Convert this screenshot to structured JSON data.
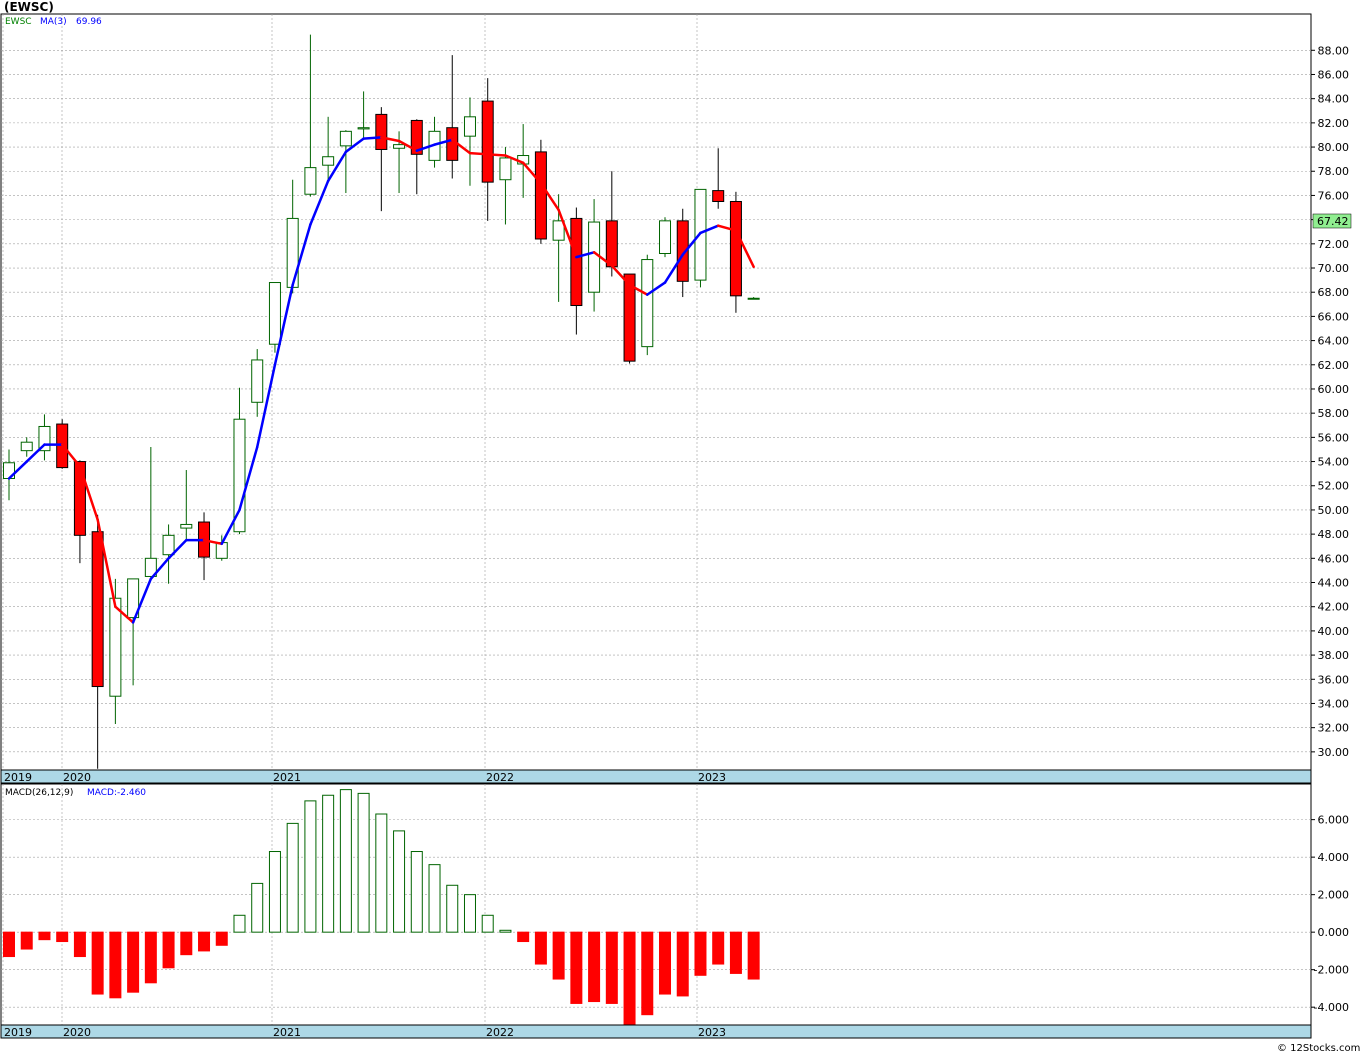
{
  "title": "(EWSC)",
  "footer": "© 12Stocks.com",
  "colors": {
    "up": "#006400",
    "down": "#ff0000",
    "ma_up": "#0000ff",
    "ma_down": "#ff0000",
    "axis_band": "#add8e6",
    "grid": "#a0a0a0",
    "last_price_bg": "#90ee90"
  },
  "chart_data": [
    {
      "type": "candlestick",
      "name": "price",
      "legend": {
        "symbol": "EWSC",
        "ma_label": "MA(3)",
        "ma_value": "69.96"
      },
      "last_price_label": "67.42",
      "y_ticks": [
        "30.00",
        "32.00",
        "34.00",
        "36.00",
        "38.00",
        "40.00",
        "42.00",
        "44.00",
        "46.00",
        "48.00",
        "50.00",
        "52.00",
        "54.00",
        "56.00",
        "58.00",
        "60.00",
        "62.00",
        "64.00",
        "66.00",
        "68.00",
        "70.00",
        "72.00",
        "74.00",
        "76.00",
        "78.00",
        "80.00",
        "82.00",
        "84.00",
        "86.00",
        "88.00"
      ],
      "x_ticks": [
        "2019",
        "2020",
        "2021",
        "2022",
        "2023"
      ],
      "ylim": [
        28.5,
        91
      ],
      "grid": true,
      "candles": [
        {
          "o": 52.6,
          "h": 55.0,
          "l": 50.8,
          "c": 53.9
        },
        {
          "o": 54.9,
          "h": 56.0,
          "l": 54.4,
          "c": 55.6
        },
        {
          "o": 54.9,
          "h": 57.9,
          "l": 54.1,
          "c": 56.9
        },
        {
          "o": 57.1,
          "h": 57.5,
          "l": 53.4,
          "c": 53.5
        },
        {
          "o": 54.0,
          "h": 54.1,
          "l": 45.6,
          "c": 47.9
        },
        {
          "o": 48.2,
          "h": 49.6,
          "l": 28.6,
          "c": 35.4
        },
        {
          "o": 34.6,
          "h": 44.3,
          "l": 32.3,
          "c": 42.7
        },
        {
          "o": 41.1,
          "h": 44.2,
          "l": 35.5,
          "c": 44.3
        },
        {
          "o": 44.5,
          "h": 55.2,
          "l": 44.3,
          "c": 46.0
        },
        {
          "o": 46.3,
          "h": 48.8,
          "l": 43.9,
          "c": 47.9
        },
        {
          "o": 48.5,
          "h": 53.3,
          "l": 47.5,
          "c": 48.8
        },
        {
          "o": 49.0,
          "h": 49.8,
          "l": 44.2,
          "c": 46.1
        },
        {
          "o": 46.0,
          "h": 47.9,
          "l": 45.8,
          "c": 47.3
        },
        {
          "o": 48.2,
          "h": 60.1,
          "l": 48.0,
          "c": 57.5
        },
        {
          "o": 58.9,
          "h": 63.3,
          "l": 57.7,
          "c": 62.4
        },
        {
          "o": 63.7,
          "h": 68.5,
          "l": 63.0,
          "c": 68.8
        },
        {
          "o": 68.4,
          "h": 77.3,
          "l": 67.9,
          "c": 74.1
        },
        {
          "o": 76.1,
          "h": 89.3,
          "l": 75.9,
          "c": 78.3
        },
        {
          "o": 78.5,
          "h": 82.5,
          "l": 77.2,
          "c": 79.2
        },
        {
          "o": 80.1,
          "h": 81.4,
          "l": 76.2,
          "c": 81.3
        },
        {
          "o": 81.5,
          "h": 84.6,
          "l": 80.7,
          "c": 81.6
        },
        {
          "o": 82.7,
          "h": 83.3,
          "l": 74.7,
          "c": 79.8
        },
        {
          "o": 79.9,
          "h": 81.3,
          "l": 76.2,
          "c": 80.2
        },
        {
          "o": 82.2,
          "h": 82.3,
          "l": 76.1,
          "c": 79.4
        },
        {
          "o": 78.9,
          "h": 82.5,
          "l": 78.3,
          "c": 81.3
        },
        {
          "o": 81.6,
          "h": 87.6,
          "l": 77.4,
          "c": 78.9
        },
        {
          "o": 80.9,
          "h": 84.1,
          "l": 76.8,
          "c": 82.5
        },
        {
          "o": 83.8,
          "h": 85.7,
          "l": 73.9,
          "c": 77.1
        },
        {
          "o": 77.3,
          "h": 80.0,
          "l": 73.6,
          "c": 79.1
        },
        {
          "o": 78.6,
          "h": 81.9,
          "l": 75.8,
          "c": 79.3
        },
        {
          "o": 79.6,
          "h": 80.6,
          "l": 72.0,
          "c": 72.4
        },
        {
          "o": 72.3,
          "h": 76.1,
          "l": 67.2,
          "c": 73.9
        },
        {
          "o": 74.1,
          "h": 75.0,
          "l": 64.5,
          "c": 66.9
        },
        {
          "o": 68.0,
          "h": 75.7,
          "l": 66.4,
          "c": 73.8
        },
        {
          "o": 73.9,
          "h": 78.0,
          "l": 69.3,
          "c": 70.1
        },
        {
          "o": 69.5,
          "h": 69.5,
          "l": 62.1,
          "c": 62.3
        },
        {
          "o": 63.5,
          "h": 71.1,
          "l": 62.8,
          "c": 70.7
        },
        {
          "o": 71.2,
          "h": 74.2,
          "l": 70.9,
          "c": 73.9
        },
        {
          "o": 73.9,
          "h": 74.9,
          "l": 67.6,
          "c": 68.9
        },
        {
          "o": 69.0,
          "h": 76.5,
          "l": 68.4,
          "c": 76.5
        },
        {
          "o": 76.4,
          "h": 79.9,
          "l": 74.9,
          "c": 75.5
        },
        {
          "o": 75.5,
          "h": 76.3,
          "l": 66.3,
          "c": 67.7
        },
        {
          "o": 67.5,
          "h": 67.6,
          "l": 67.4,
          "c": 67.5
        }
      ],
      "ma3": [
        52.6,
        54.0,
        55.4,
        55.4,
        53.6,
        49.2,
        42.0,
        40.7,
        44.3,
        46.0,
        47.5,
        47.5,
        47.2,
        50.0,
        55.2,
        62.0,
        68.6,
        73.6,
        77.2,
        79.6,
        80.7,
        80.8,
        80.5,
        79.7,
        80.2,
        80.6,
        79.5,
        79.4,
        79.3,
        78.7,
        77.0,
        74.8,
        70.9,
        71.3,
        70.2,
        68.6,
        67.8,
        68.8,
        71.1,
        72.9,
        73.5,
        73.1,
        70.1
      ]
    },
    {
      "type": "bar",
      "name": "macd_histogram",
      "legend": {
        "label": "MACD(26,12,9)",
        "value_label": "MACD:-2.460"
      },
      "y_ticks": [
        "-4.000",
        "-2.000",
        "0.000",
        "2.000",
        "4.000",
        "6.000"
      ],
      "x_ticks": [
        "2019",
        "2020",
        "2021",
        "2022",
        "2023"
      ],
      "ylim": [
        -4.95,
        7.9
      ],
      "grid": true,
      "values": [
        -1.3,
        -0.9,
        -0.4,
        -0.5,
        -1.3,
        -3.3,
        -3.5,
        -3.2,
        -2.7,
        -1.9,
        -1.2,
        -1.0,
        -0.7,
        0.9,
        2.6,
        4.3,
        5.8,
        7.0,
        7.3,
        7.6,
        7.4,
        6.3,
        5.4,
        4.3,
        3.6,
        2.5,
        2.0,
        0.9,
        0.1,
        -0.5,
        -1.7,
        -2.5,
        -3.8,
        -3.7,
        -3.8,
        -4.9,
        -4.4,
        -3.3,
        -3.4,
        -2.3,
        -1.7,
        -2.2,
        -2.5
      ]
    }
  ]
}
